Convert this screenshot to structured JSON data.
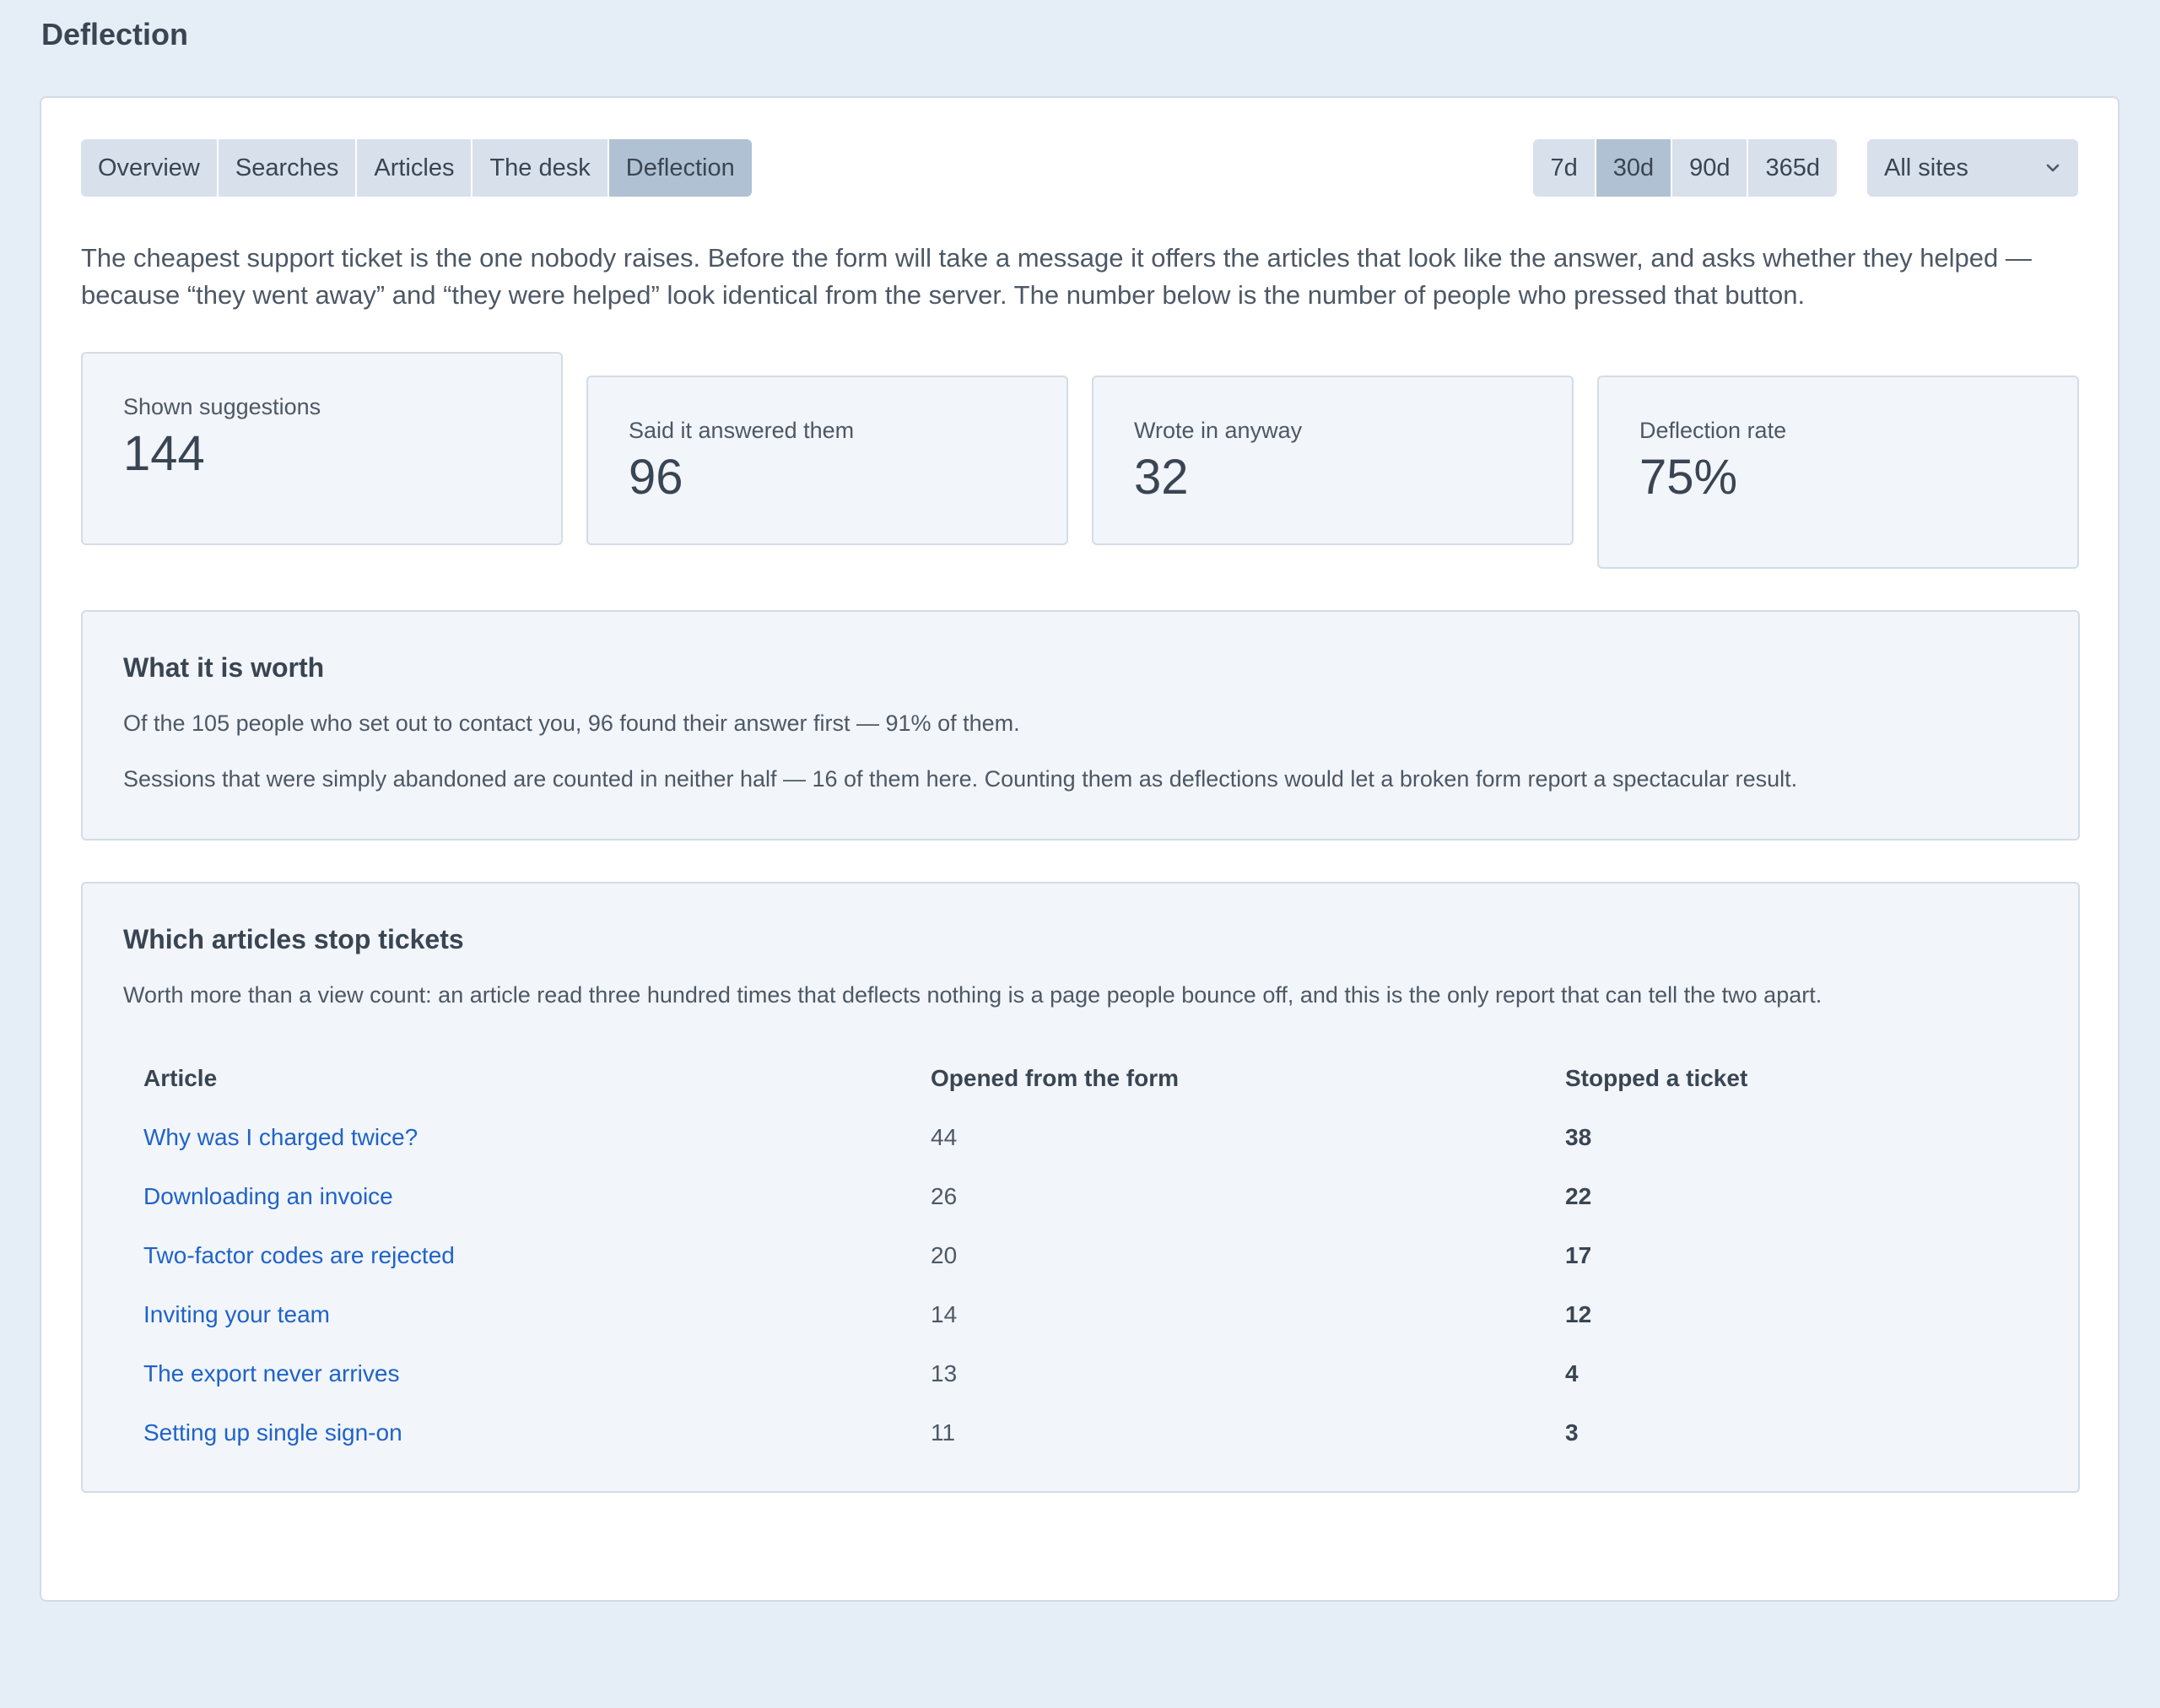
{
  "page": {
    "title": "Deflection"
  },
  "tabs": [
    {
      "label": "Overview",
      "active": false
    },
    {
      "label": "Searches",
      "active": false
    },
    {
      "label": "Articles",
      "active": false
    },
    {
      "label": "The desk",
      "active": false
    },
    {
      "label": "Deflection",
      "active": true
    }
  ],
  "ranges": [
    {
      "label": "7d",
      "active": false
    },
    {
      "label": "30d",
      "active": true
    },
    {
      "label": "90d",
      "active": false
    },
    {
      "label": "365d",
      "active": false
    }
  ],
  "site_select": {
    "value": "All sites"
  },
  "intro": "The cheapest support ticket is the one nobody raises. Before the form will take a message it offers the articles that look like the answer, and asks whether they helped — because “they went away” and “they were helped” look identical from the server. The number below is the number of people who pressed that button.",
  "stats": [
    {
      "label": "Shown suggestions",
      "value": "144"
    },
    {
      "label": "Said it answered them",
      "value": "96"
    },
    {
      "label": "Wrote in anyway",
      "value": "32"
    },
    {
      "label": "Deflection rate",
      "value": "75%"
    }
  ],
  "worth": {
    "title": "What it is worth",
    "line1": "Of the 105 people who set out to contact you, 96 found their answer first — 91% of them.",
    "line2": "Sessions that were simply abandoned are counted in neither half — 16 of them here. Counting them as deflections would let a broken form report a spectacular result."
  },
  "articles": {
    "title": "Which articles stop tickets",
    "description": "Worth more than a view count: an article read three hundred times that deflects nothing is a page people bounce off, and this is the only report that can tell the two apart.",
    "columns": [
      "Article",
      "Opened from the form",
      "Stopped a ticket"
    ],
    "rows": [
      {
        "article": "Why was I charged twice?",
        "opened": "44",
        "stopped": "38"
      },
      {
        "article": "Downloading an invoice",
        "opened": "26",
        "stopped": "22"
      },
      {
        "article": "Two-factor codes are rejected",
        "opened": "20",
        "stopped": "17"
      },
      {
        "article": "Inviting your team",
        "opened": "14",
        "stopped": "12"
      },
      {
        "article": "The export never arrives",
        "opened": "13",
        "stopped": "4"
      },
      {
        "article": "Setting up single sign-on",
        "opened": "11",
        "stopped": "3"
      }
    ]
  },
  "icons": {
    "select_arrow": "chevron-down-icon"
  },
  "colors": {
    "link": "#1f63c9",
    "active_segment": "#b1c1d4",
    "segment": "#d8e1eb"
  }
}
